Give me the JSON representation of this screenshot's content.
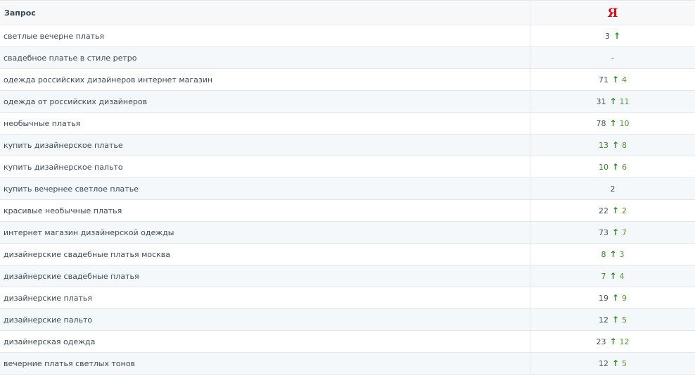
{
  "header": {
    "query_label": "Запрос",
    "engine_logo": "Я"
  },
  "colors": {
    "yandex_red": "#d0141b",
    "up_arrow": "#2e8a23",
    "delta_green": "#4f9a2f"
  },
  "rows": [
    {
      "query": "светлые вечерне платья",
      "position": "3",
      "arrow": "↑",
      "delta": "",
      "position_green": false
    },
    {
      "query": "свадебное платье в стиле ретро",
      "position": "-",
      "arrow": "",
      "delta": "",
      "position_green": false
    },
    {
      "query": "одежда российских дизайнеров интернет магазин",
      "position": "71",
      "arrow": "↑",
      "delta": "4",
      "position_green": false
    },
    {
      "query": "одежда от российских дизайнеров",
      "position": "31",
      "arrow": "↑",
      "delta": "11",
      "position_green": false
    },
    {
      "query": "необычные платья",
      "position": "78",
      "arrow": "↑",
      "delta": "10",
      "position_green": false
    },
    {
      "query": "купить дизайнерское платье",
      "position": "13",
      "arrow": "↑",
      "delta": "8",
      "position_green": true
    },
    {
      "query": "купить дизайнерское пальто",
      "position": "10",
      "arrow": "↑",
      "delta": "6",
      "position_green": true
    },
    {
      "query": "купить вечернее светлое платье",
      "position": "2",
      "arrow": "",
      "delta": "",
      "position_green": false
    },
    {
      "query": "красивые необычные платья",
      "position": "22",
      "arrow": "↑",
      "delta": "2",
      "position_green": false
    },
    {
      "query": "интернет магазин дизайнерской одежды",
      "position": "73",
      "arrow": "↑",
      "delta": "7",
      "position_green": false
    },
    {
      "query": "дизайнерские свадебные платья москва",
      "position": "8",
      "arrow": "↑",
      "delta": "3",
      "position_green": true
    },
    {
      "query": "дизайнерские свадебные платья",
      "position": "7",
      "arrow": "↑",
      "delta": "4",
      "position_green": true
    },
    {
      "query": "дизайнерские платья",
      "position": "19",
      "arrow": "↑",
      "delta": "9",
      "position_green": false
    },
    {
      "query": "дизайнерские пальто",
      "position": "12",
      "arrow": "↑",
      "delta": "5",
      "position_green": false
    },
    {
      "query": "дизайнерская одежда",
      "position": "23",
      "arrow": "↑",
      "delta": "12",
      "position_green": false
    },
    {
      "query": "вечерние платья светлых тонов",
      "position": "12",
      "arrow": "↑",
      "delta": "5",
      "position_green": false
    }
  ]
}
